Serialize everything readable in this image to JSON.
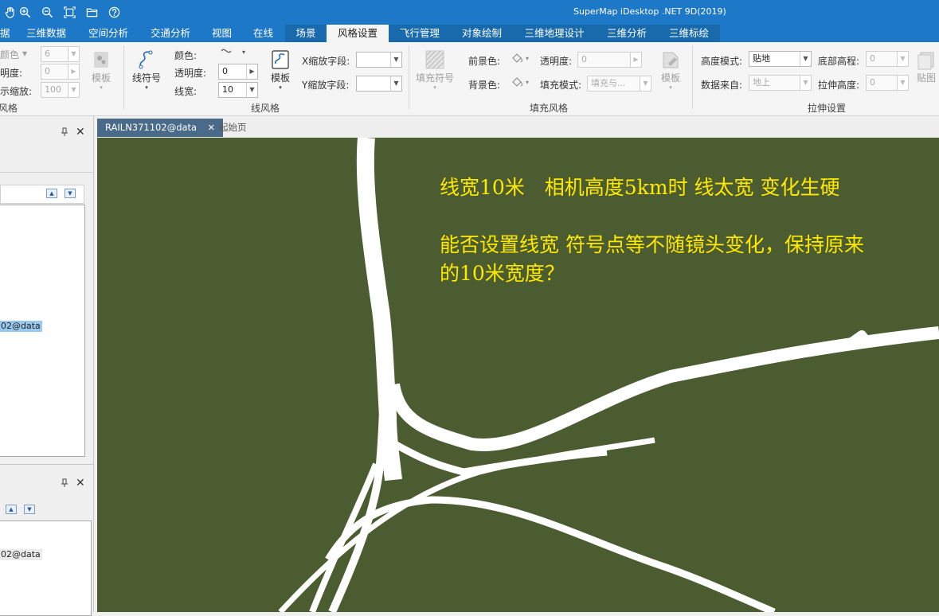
{
  "window": {
    "title": "SuperMap iDesktop .NET 9D(2019)",
    "quick_access_icons": [
      "pan-hand-icon",
      "zoom-in-icon",
      "zoom-out-icon",
      "full-extent-icon",
      "open-folder-icon",
      "help-icon"
    ]
  },
  "tabs": [
    {
      "label": "据"
    },
    {
      "label": "三维数据"
    },
    {
      "label": "空间分析"
    },
    {
      "label": "交通分析"
    },
    {
      "label": "视图"
    },
    {
      "label": "在线"
    },
    {
      "label": "场景"
    },
    {
      "label": "风格设置"
    },
    {
      "label": "飞行管理"
    },
    {
      "label": "对象绘制"
    },
    {
      "label": "三维地理设计"
    },
    {
      "label": "三维分析"
    },
    {
      "label": "三维标绘"
    }
  ],
  "ribbon": {
    "point_group": {
      "title": "风格",
      "color_label": "颜色",
      "color_arrow": "▾",
      "size_value": "6",
      "opacity_label": "明度:",
      "opacity_value": "0",
      "scale_label": "示缩放:",
      "scale_value": "100",
      "template_label": "模板"
    },
    "line_group": {
      "title": "线风格",
      "symbol_label": "线符号",
      "color_label": "颜色:",
      "opacity_label": "透明度:",
      "opacity_value": "0",
      "width_label": "线宽:",
      "width_value": "10",
      "template_label": "模板",
      "x_scale_label": "X缩放字段:",
      "y_scale_label": "Y缩放字段:"
    },
    "fill_group": {
      "title": "填充风格",
      "fill_symbol_label": "填充符号",
      "fg_color_label": "前景色:",
      "bg_color_label": "背景色:",
      "opacity_label": "透明度:",
      "opacity_value": "0",
      "fill_mode_label": "填充模式:",
      "fill_mode_value": "填充与...",
      "template_label": "模板"
    },
    "extrude_group": {
      "title": "拉伸设置",
      "height_mode_label": "高度模式:",
      "height_mode_value": "贴地",
      "bottom_alt_label": "底部高程:",
      "bottom_alt_value": "0",
      "data_source_label": "数据来自:",
      "data_source_value": "地上",
      "extrude_height_label": "拉伸高度:",
      "extrude_height_value": "0",
      "texture_label": "贴图"
    }
  },
  "left_panel": {
    "top_item": "02@data",
    "bottom_item": "02@data",
    "pin_icon": "pin-icon",
    "close_icon": "close-icon"
  },
  "doc_tabs": {
    "active_tab": "RAILN371102@data",
    "close_glyph": "✕",
    "second_tab": "起始页"
  },
  "map": {
    "background_color": "#4b5c31",
    "line_color": "#ffffff",
    "annotation_color": "#ffe900",
    "annotation_line1": "线宽10米　相机高度5km时 线太宽 变化生硬",
    "annotation_line2": "能否设置线宽 符号点等不随镜头变化，保持原来",
    "annotation_line3": "的10米宽度？"
  }
}
